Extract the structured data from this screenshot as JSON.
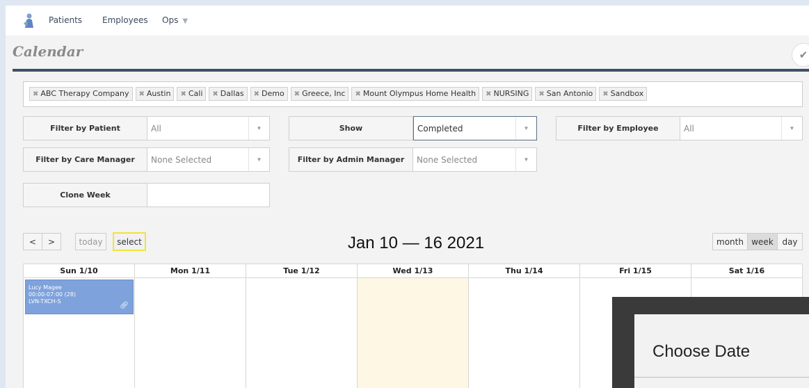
{
  "nav": {
    "items": [
      "Patients",
      "Employees",
      "Ops"
    ]
  },
  "page": {
    "title": "Calendar"
  },
  "tags": [
    "ABC Therapy Company",
    "Austin",
    "Cali",
    "Dallas",
    "Demo",
    "Greece, Inc",
    "Mount Olympus Home Health",
    "NURSING",
    "San Antonio",
    "Sandbox"
  ],
  "filters": {
    "patient": {
      "label": "Filter by Patient",
      "value": "All"
    },
    "show": {
      "label": "Show",
      "value": "Completed"
    },
    "employee": {
      "label": "Filter by Employee",
      "value": "All"
    },
    "care_manager": {
      "label": "Filter by Care Manager",
      "value": "None Selected"
    },
    "admin_manager": {
      "label": "Filter by Admin Manager",
      "value": "None Selected"
    },
    "clone_week": {
      "label": "Clone Week",
      "value": ""
    }
  },
  "toolbar": {
    "prev": "<",
    "next": ">",
    "today": "today",
    "select": "select",
    "range": "Jan 10 — 16 2021",
    "views": [
      "month",
      "week",
      "day"
    ],
    "active_view": "week"
  },
  "calendar": {
    "days": [
      "Sun 1/10",
      "Mon 1/11",
      "Tue 1/12",
      "Wed 1/13",
      "Thu 1/14",
      "Fri 1/15",
      "Sat 1/16"
    ],
    "today_index": 3,
    "events": [
      {
        "name": "Lucy Magee",
        "time": "00:00-07:00 (28)",
        "code": "LVN-TXCH-S",
        "day_index": 0
      }
    ]
  },
  "modal": {
    "title": "Choose Date"
  },
  "colors": {
    "accent": "#3f5067",
    "event": "#7ea2db",
    "today_bg": "#fdf7e3",
    "select_highlight": "#f0e43a"
  }
}
